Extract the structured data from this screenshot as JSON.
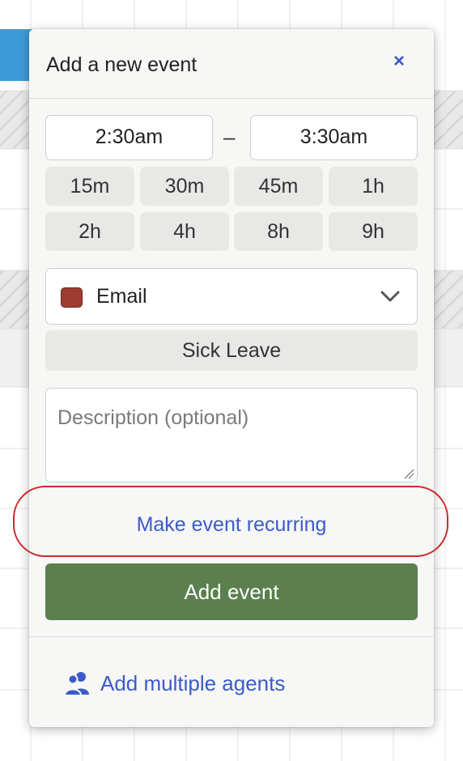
{
  "dialog": {
    "title": "Add a new event",
    "close_label": "×"
  },
  "time": {
    "start": "2:30am",
    "separator": "–",
    "end": "3:30am"
  },
  "durations": [
    "15m",
    "30m",
    "45m",
    "1h",
    "2h",
    "4h",
    "8h",
    "9h"
  ],
  "activity": {
    "selected": "Email",
    "swatch_color": "#9d3c31",
    "quick_option": "Sick Leave"
  },
  "description": {
    "placeholder": "Description (optional)"
  },
  "actions": {
    "recurring_label": "Make event recurring",
    "add_label": "Add event",
    "multi_agents_label": "Add multiple agents"
  },
  "colors": {
    "link": "#3b5bc9",
    "primary": "#5b7f4e",
    "highlight": "#cc2a2a"
  }
}
